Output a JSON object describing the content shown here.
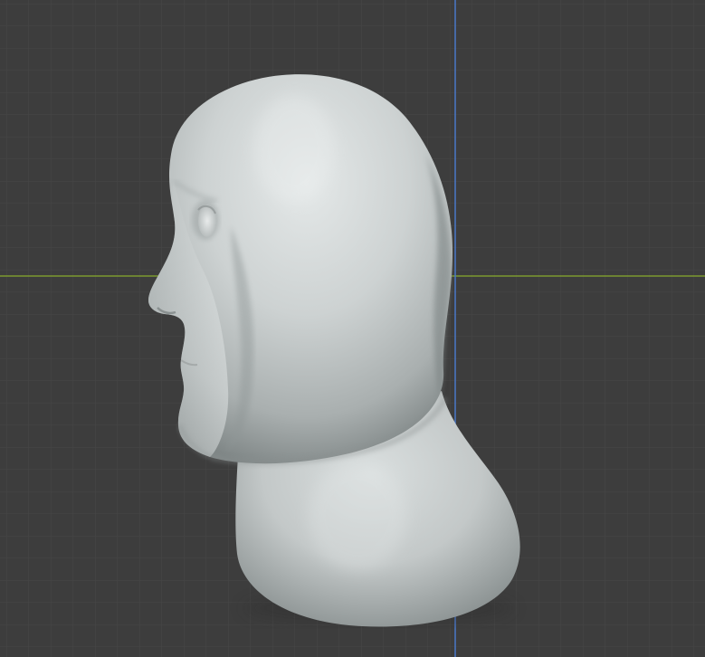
{
  "viewport": {
    "background_color": "#3d3d3d",
    "grid_minor_color": "#474747",
    "grid_major_color": "#505050",
    "x_axis_color": "#7c9a2e",
    "y_axis_color": "#4a78c8",
    "object_base_color": "#c6cbcb",
    "object_shadow_color": "#6e7474",
    "object_highlight_color": "#e4e8e8"
  },
  "scene": {
    "object_kind": "sculpted-head-mesh",
    "view": "side-profile-left",
    "grid_visible": true,
    "axes_visible": [
      "x-axis",
      "y-axis"
    ]
  }
}
